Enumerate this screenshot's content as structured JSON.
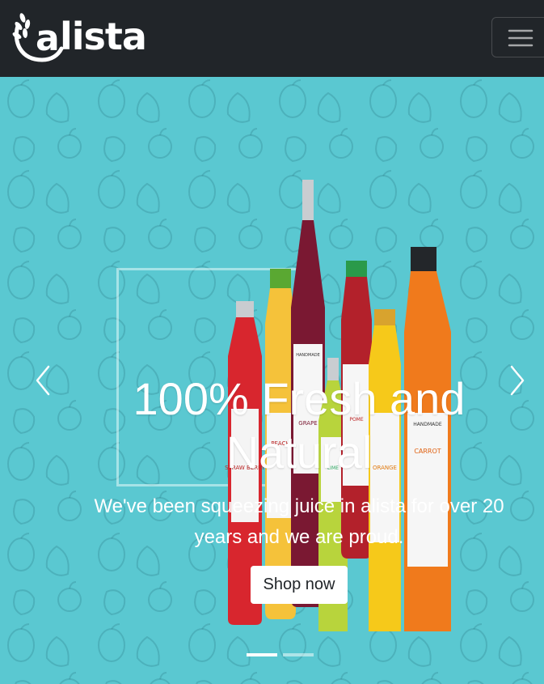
{
  "navbar": {
    "brand": "lista",
    "brand_mark_letter": "a",
    "menu_icon": "hamburger-menu-icon",
    "background": "#212529"
  },
  "carousel": {
    "background": "#5ac8d1",
    "prev_icon": "chevron-left-icon",
    "next_icon": "chevron-right-icon",
    "slide": {
      "title": "100% Fresh and Natural",
      "text": "We've been squeezing juice in alista for over 20 years and we are proud.",
      "button_label": "Shop now"
    },
    "indicators": [
      {
        "active": true
      },
      {
        "active": false
      }
    ],
    "bottle_labels": [
      "STRAW BERRY",
      "PEACH",
      "GRAPE",
      "LIME",
      "POME",
      "ORANGE",
      "CARROT"
    ],
    "bottle_label_top": "HANDMADE"
  }
}
